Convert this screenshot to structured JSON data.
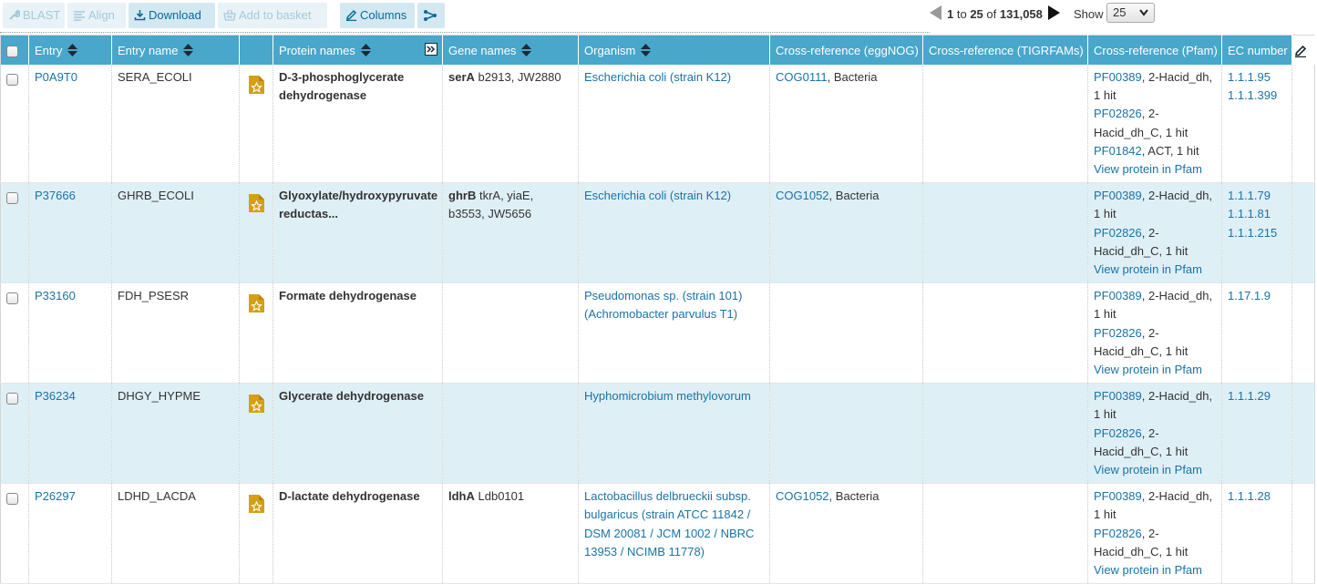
{
  "toolbar": {
    "blast": "BLAST",
    "align": "Align",
    "download": "Download",
    "add_to_basket": "Add to basket",
    "columns": "Columns"
  },
  "pager": {
    "from": "1",
    "to_word": "to",
    "to": "25",
    "of_word": "of",
    "total": "131,058"
  },
  "show": {
    "label": "Show",
    "value": "25"
  },
  "headers": {
    "entry": "Entry",
    "entry_name": "Entry name",
    "protein_names": "Protein names",
    "gene_names": "Gene names",
    "organism": "Organism",
    "eggnog": "Cross-reference (eggNOG)",
    "tigrfams": "Cross-reference (TIGRFAMs)",
    "pfam": "Cross-reference (Pfam)",
    "ec": "EC number"
  },
  "rows": [
    {
      "entry": "P0A9T0",
      "entry_name": "SERA_ECOLI",
      "protein": "D-3-phosphoglycerate dehydrogenase",
      "gene_primary": "serA",
      "gene_other": "b2913, JW2880",
      "organism": "Escherichia coli (strain K12)",
      "eggnog_id": "COG0111",
      "eggnog_rest": ", Bacteria",
      "pfam": [
        {
          "id": "PF00389",
          "text": ", 2-Hacid_dh, 1 hit"
        },
        {
          "id": "PF02826",
          "text": ", 2-Hacid_dh_C, 1 hit"
        },
        {
          "id": "PF01842",
          "text": ", ACT, 1 hit"
        }
      ],
      "pfam_link": "View protein in Pfam",
      "ec": [
        "1.1.1.95",
        "1.1.1.399"
      ]
    },
    {
      "entry": "P37666",
      "entry_name": "GHRB_ECOLI",
      "protein": "Glyoxylate/hydroxypyruvate reductas...",
      "gene_primary": "ghrB",
      "gene_other": "tkrA, yiaE, b3553, JW5656",
      "organism": "Escherichia coli (strain K12)",
      "eggnog_id": "COG1052",
      "eggnog_rest": ", Bacteria",
      "pfam": [
        {
          "id": "PF00389",
          "text": ", 2-Hacid_dh, 1 hit"
        },
        {
          "id": "PF02826",
          "text": ", 2-Hacid_dh_C, 1 hit"
        }
      ],
      "pfam_link": "View protein in Pfam",
      "ec": [
        "1.1.1.79",
        "1.1.1.81",
        "1.1.1.215"
      ]
    },
    {
      "entry": "P33160",
      "entry_name": "FDH_PSESR",
      "protein": "Formate dehydrogenase",
      "gene_primary": "",
      "gene_other": "",
      "organism": "Pseudomonas sp. (strain 101) (Achromobacter parvulus T1)",
      "eggnog_id": "",
      "eggnog_rest": "",
      "pfam": [
        {
          "id": "PF00389",
          "text": ", 2-Hacid_dh, 1 hit"
        },
        {
          "id": "PF02826",
          "text": ", 2-Hacid_dh_C, 1 hit"
        }
      ],
      "pfam_link": "View protein in Pfam",
      "ec": [
        "1.17.1.9"
      ]
    },
    {
      "entry": "P36234",
      "entry_name": "DHGY_HYPME",
      "protein": "Glycerate dehydrogenase",
      "gene_primary": "",
      "gene_other": "",
      "organism": "Hyphomicrobium methylovorum",
      "eggnog_id": "",
      "eggnog_rest": "",
      "pfam": [
        {
          "id": "PF00389",
          "text": ", 2-Hacid_dh, 1 hit"
        },
        {
          "id": "PF02826",
          "text": ", 2-Hacid_dh_C, 1 hit"
        }
      ],
      "pfam_link": "View protein in Pfam",
      "ec": [
        "1.1.1.29"
      ]
    },
    {
      "entry": "P26297",
      "entry_name": "LDHD_LACDA",
      "protein": "D-lactate dehydrogenase",
      "gene_primary": "ldhA",
      "gene_other": "Ldb0101",
      "organism": "Lactobacillus delbrueckii subsp. bulgaricus (strain ATCC 11842 / DSM 20081 / JCM 1002 / NBRC 13953 / NCIMB 11778)",
      "eggnog_id": "COG1052",
      "eggnog_rest": ", Bacteria",
      "pfam": [
        {
          "id": "PF00389",
          "text": ", 2-Hacid_dh, 1 hit"
        },
        {
          "id": "PF02826",
          "text": ", 2-Hacid_dh_C, 1 hit"
        }
      ],
      "pfam_link": "View protein in Pfam",
      "ec": [
        "1.1.1.28"
      ]
    }
  ],
  "colors": {
    "header": "#48a7cb",
    "link": "#1a73a6",
    "alt_row": "#dfeff6",
    "doc_icon": "#d4a017"
  },
  "icons": {
    "blast": "wrench-icon",
    "align": "align-icon",
    "download": "download-icon",
    "basket": "basket-icon",
    "columns": "pencil-icon",
    "share": "share-icon",
    "sort": "sort-arrows-icon",
    "expand": "expand-column-icon",
    "edit": "edit-columns-icon",
    "review": "reviewed-document-icon"
  }
}
